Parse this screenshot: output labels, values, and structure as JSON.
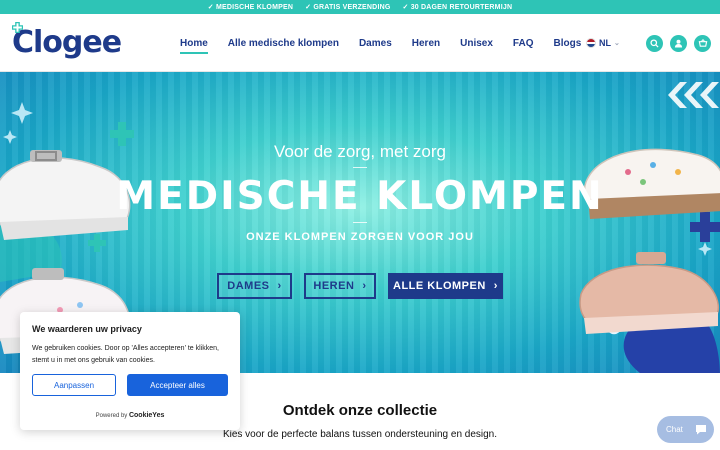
{
  "topbar": {
    "items": [
      "✓ MEDISCHE KLOMPEN",
      "✓ GRATIS VERZENDING",
      "✓ 30 DAGEN RETOURTERMIJN"
    ]
  },
  "header": {
    "logo": "Clogee",
    "nav": [
      {
        "label": "Home",
        "active": true
      },
      {
        "label": "Alle medische klompen",
        "active": false
      },
      {
        "label": "Dames",
        "active": false
      },
      {
        "label": "Heren",
        "active": false
      },
      {
        "label": "Unisex",
        "active": false
      },
      {
        "label": "FAQ",
        "active": false
      },
      {
        "label": "Blogs",
        "active": false
      }
    ],
    "language": "NL",
    "icons": [
      "search-icon",
      "account-icon",
      "cart-icon"
    ]
  },
  "hero": {
    "subtitle": "Voor de zorg, met zorg",
    "title": "MEDISCHE KLOMPEN",
    "tagline": "ONZE KLOMPEN ZORGEN VOOR JOU",
    "buttons": [
      "DAMES",
      "HEREN",
      "ALLE KLOMPEN"
    ]
  },
  "collection": {
    "title": "Ontdek onze collectie",
    "subtitle": "Kies voor de perfecte balans tussen ondersteuning en design."
  },
  "cookie": {
    "title": "We waarderen uw privacy",
    "text": "We gebruiken cookies. Door op 'Alles accepteren' te klikken, stemt u in met ons gebruik van cookies.",
    "customize_label": "Aanpassen",
    "accept_label": "Accepteer alles",
    "powered_by": "Powered by",
    "brand": "CookieYes"
  },
  "chat": {
    "label": "Chat"
  },
  "colors": {
    "teal": "#2ec4b6",
    "navy": "#1e3a8a",
    "cookie_blue": "#1863dc"
  }
}
